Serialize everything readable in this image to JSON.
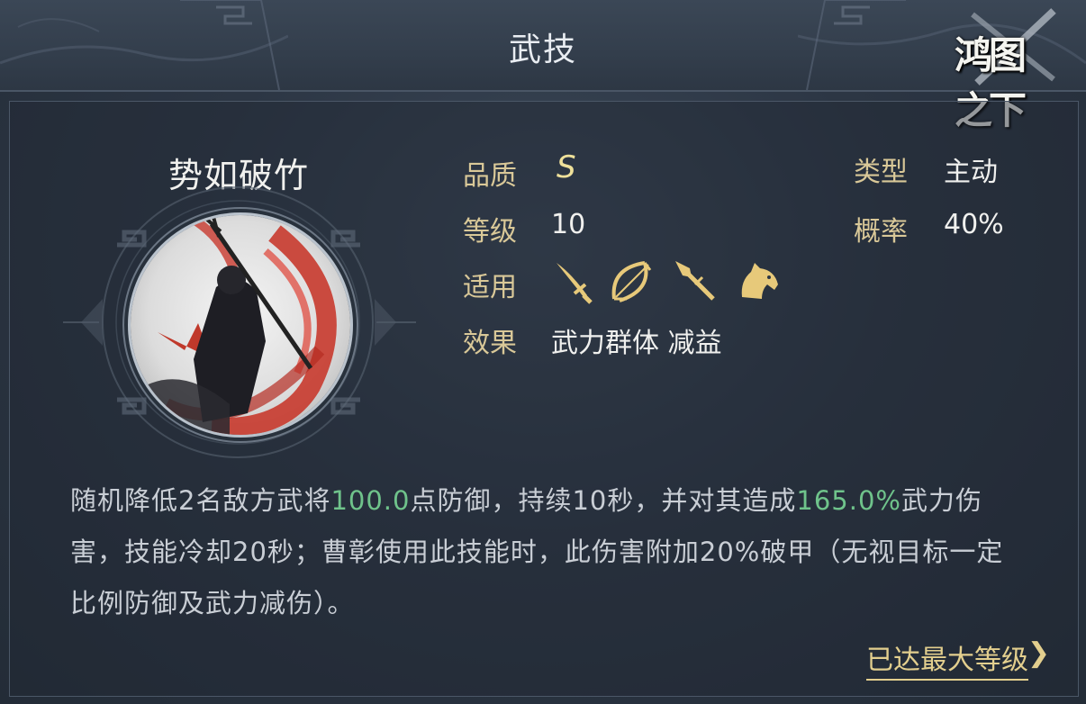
{
  "header": {
    "title": "武技",
    "logo_text": "鸿图之下"
  },
  "skill": {
    "name": "势如破竹",
    "quality_label": "品质",
    "quality_value": "S",
    "type_label": "类型",
    "type_value": "主动",
    "level_label": "等级",
    "level_value": "10",
    "chance_label": "概率",
    "chance_value": "40%",
    "applicable_label": "适用",
    "applicable_icons": [
      "sword-icon",
      "bow-icon",
      "spear-icon",
      "horse-icon"
    ],
    "effect_label": "效果",
    "effect_value": "武力群体 减益"
  },
  "description": {
    "p1": "随机降低2名敌方武将",
    "v1": "100.0",
    "p2": "点防御，持续10秒，并对其造成",
    "v2": "165.0%",
    "p3": "武力伤害，技能冷却20秒；曹彰使用此技能时，此伤害附加20%破甲（无视目标一定比例防御及武力减伤）。"
  },
  "footer": {
    "max_level": "已达最大等级",
    "chevron": "❯"
  },
  "colors": {
    "gold": "#d9c898",
    "highlight_green": "#6fc38b",
    "quality": "#efe19a"
  }
}
